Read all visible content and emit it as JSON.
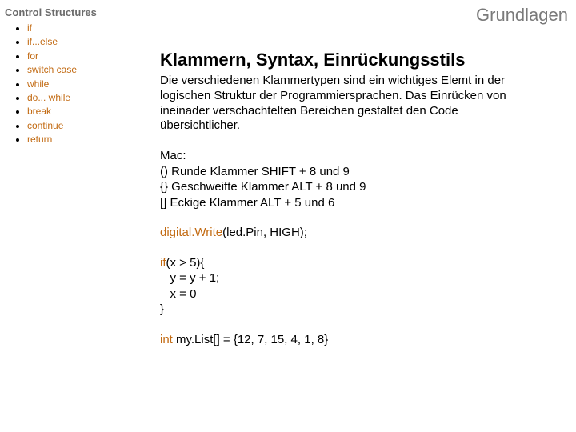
{
  "header": {
    "corner_label": "Grundlagen"
  },
  "sidebar": {
    "title": "Control Structures",
    "items": [
      {
        "label": "if"
      },
      {
        "label": "if...else"
      },
      {
        "label": "for"
      },
      {
        "label": "switch case"
      },
      {
        "label": "while"
      },
      {
        "label": "do... while"
      },
      {
        "label": "break"
      },
      {
        "label": "continue"
      },
      {
        "label": "return"
      }
    ]
  },
  "main": {
    "title": "Klammern, Syntax, Einrückungsstils",
    "paragraph": "Die verschiedenen Klammertypen sind ein wichtiges Elemt in der logischen Struktur der Programmiersprachen. Das Einrücken von ineinader verschachtelten Bereichen gestaltet den Code übersichtlicher.",
    "shortcuts": {
      "heading": "Mac:",
      "lines": [
        "() Runde Klammer SHIFT + 8 und 9",
        "{} Geschweifte Klammer ALT + 8 und 9",
        "[] Eckige Klammer ALT + 5 und 6"
      ]
    },
    "code1": {
      "kw": "digital.Write",
      "rest": "(led.Pin, HIGH);"
    },
    "code2": {
      "kw": "if",
      "line1_rest": "(x > 5){",
      "line2": "   y = y + 1;",
      "line3": "   x = 0",
      "line4": "}"
    },
    "code3": {
      "kw": "int",
      "rest": " my.List[] = {12, 7, 15, 4, 1, 8}"
    }
  }
}
